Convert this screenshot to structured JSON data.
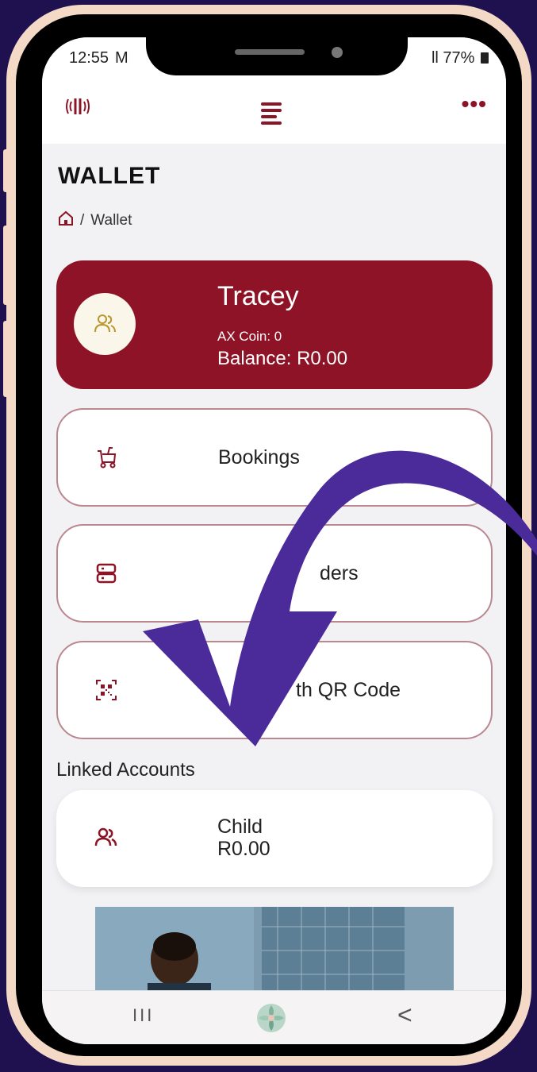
{
  "status_bar": {
    "time": "12:55",
    "left_icons": "M",
    "signal_battery": "ll 77%"
  },
  "header": {
    "logo_icon": "nfc-waves-icon",
    "menu_icon": "menu-lines-icon",
    "more_icon": "more-dots-icon",
    "more_glyph": "•••"
  },
  "page": {
    "title": "WALLET",
    "breadcrumb_separator": "/",
    "breadcrumb_current": "Wallet"
  },
  "wallet": {
    "name": "Tracey",
    "coin": "AX Coin: 0",
    "balance": "Balance: R0.00"
  },
  "menu": [
    {
      "label": "Bookings",
      "icon": "stroller-icon"
    },
    {
      "label": "ders",
      "icon": "server-icon"
    },
    {
      "label": "th QR Code",
      "icon": "qr-code-icon"
    }
  ],
  "linked": {
    "section_label": "Linked Accounts",
    "accounts": [
      {
        "name": "Child",
        "balance": "R0.00",
        "icon": "users-icon"
      }
    ]
  },
  "nav": {
    "recent_glyph": "III",
    "back_glyph": "<"
  },
  "colors": {
    "brand": "#8e1326",
    "background": "#1f1150",
    "frame": "#f3d9c6",
    "arrow": "#4b2a9a"
  }
}
